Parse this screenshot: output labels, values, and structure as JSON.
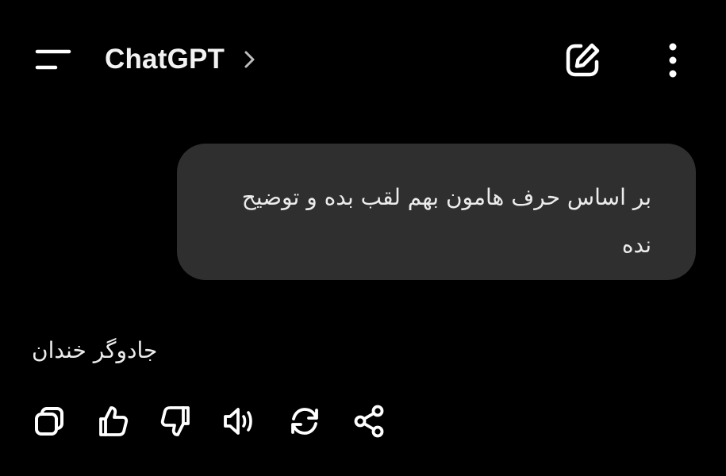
{
  "header": {
    "title": "ChatGPT",
    "icons": {
      "menu": "hamburger-menu-icon",
      "chevron": "chevron-right-icon",
      "new_chat": "new-chat-edit-icon",
      "more": "more-vertical-icon"
    }
  },
  "conversation": {
    "user_message": "بر اساس حرف هامون بهم لقب بده و توضیح نده",
    "assistant_message": "جادوگر خندان"
  },
  "actions": [
    "copy-icon",
    "thumbs-up-icon",
    "thumbs-down-icon",
    "read-aloud-icon",
    "regenerate-icon",
    "share-icon"
  ],
  "colors": {
    "background": "#000000",
    "bubble": "#2f2f2f",
    "text": "#ececec",
    "icon": "#ffffff"
  }
}
